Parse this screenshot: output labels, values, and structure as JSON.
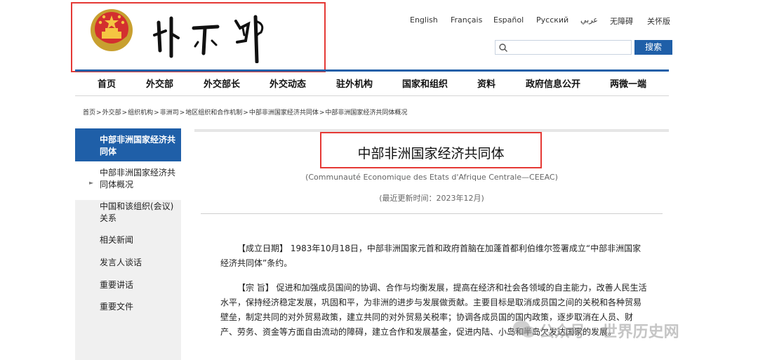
{
  "header": {
    "languages": [
      "English",
      "Français",
      "Español",
      "Русский",
      "عربي",
      "无障碍",
      "关怀版"
    ],
    "search_button": "搜索",
    "search_placeholder": ""
  },
  "nav": [
    "首页",
    "外交部",
    "外交部长",
    "外交动态",
    "驻外机构",
    "国家和组织",
    "资料",
    "政府信息公开",
    "两微一端"
  ],
  "breadcrumb": [
    "首页",
    "外交部",
    "组织机构",
    "非洲司",
    "地区组织和合作机制",
    "中部非洲国家经济共同体",
    "中部非洲国家经济共同体概况"
  ],
  "sidebar": {
    "heading": "中部非洲国家经济共同体",
    "items": [
      "中部非洲国家经济共同体概况",
      "中国和该组织(会议)关系",
      "相关新闻",
      "发言人谈话",
      "重要讲话",
      "重要文件"
    ]
  },
  "article": {
    "title": "中部非洲国家经济共同体",
    "subtitle": "(Communauté Economique des Etats d'Afrique Centrale—CEEAC)",
    "updated": "(最近更新时间：2023年12月)",
    "p1_label": "【成立日期】",
    "p1_text": " 1983年10月18日，中部非洲国家元首和政府首脑在加蓬首都利伯维尔签署成立“中部非洲国家经济共同体”条约。",
    "p2_label": "【宗  旨】",
    "p2_text": " 促进和加强成员国间的协调、合作与均衡发展，提高在经济和社会各领域的自主能力，改善人民生活水平，保持经济稳定发展，巩固和平，为非洲的进步与发展做贡献。主要目标是取消成员国之间的关税和各种贸易壁垒，制定共同的对外贸易政策，建立共同的对外贸易关税率；协调各成员国的国内政策，逐步取消在人员、财产、劳务、资金等方面自由流动的障碍，建立合作和发展基金，促进内陆、小岛和半岛欠发达国家的发展。"
  },
  "watermark": "公众号 · 世界历史网",
  "colors": {
    "brand_blue": "#1f5fa8",
    "highlight_red": "#e53935"
  }
}
